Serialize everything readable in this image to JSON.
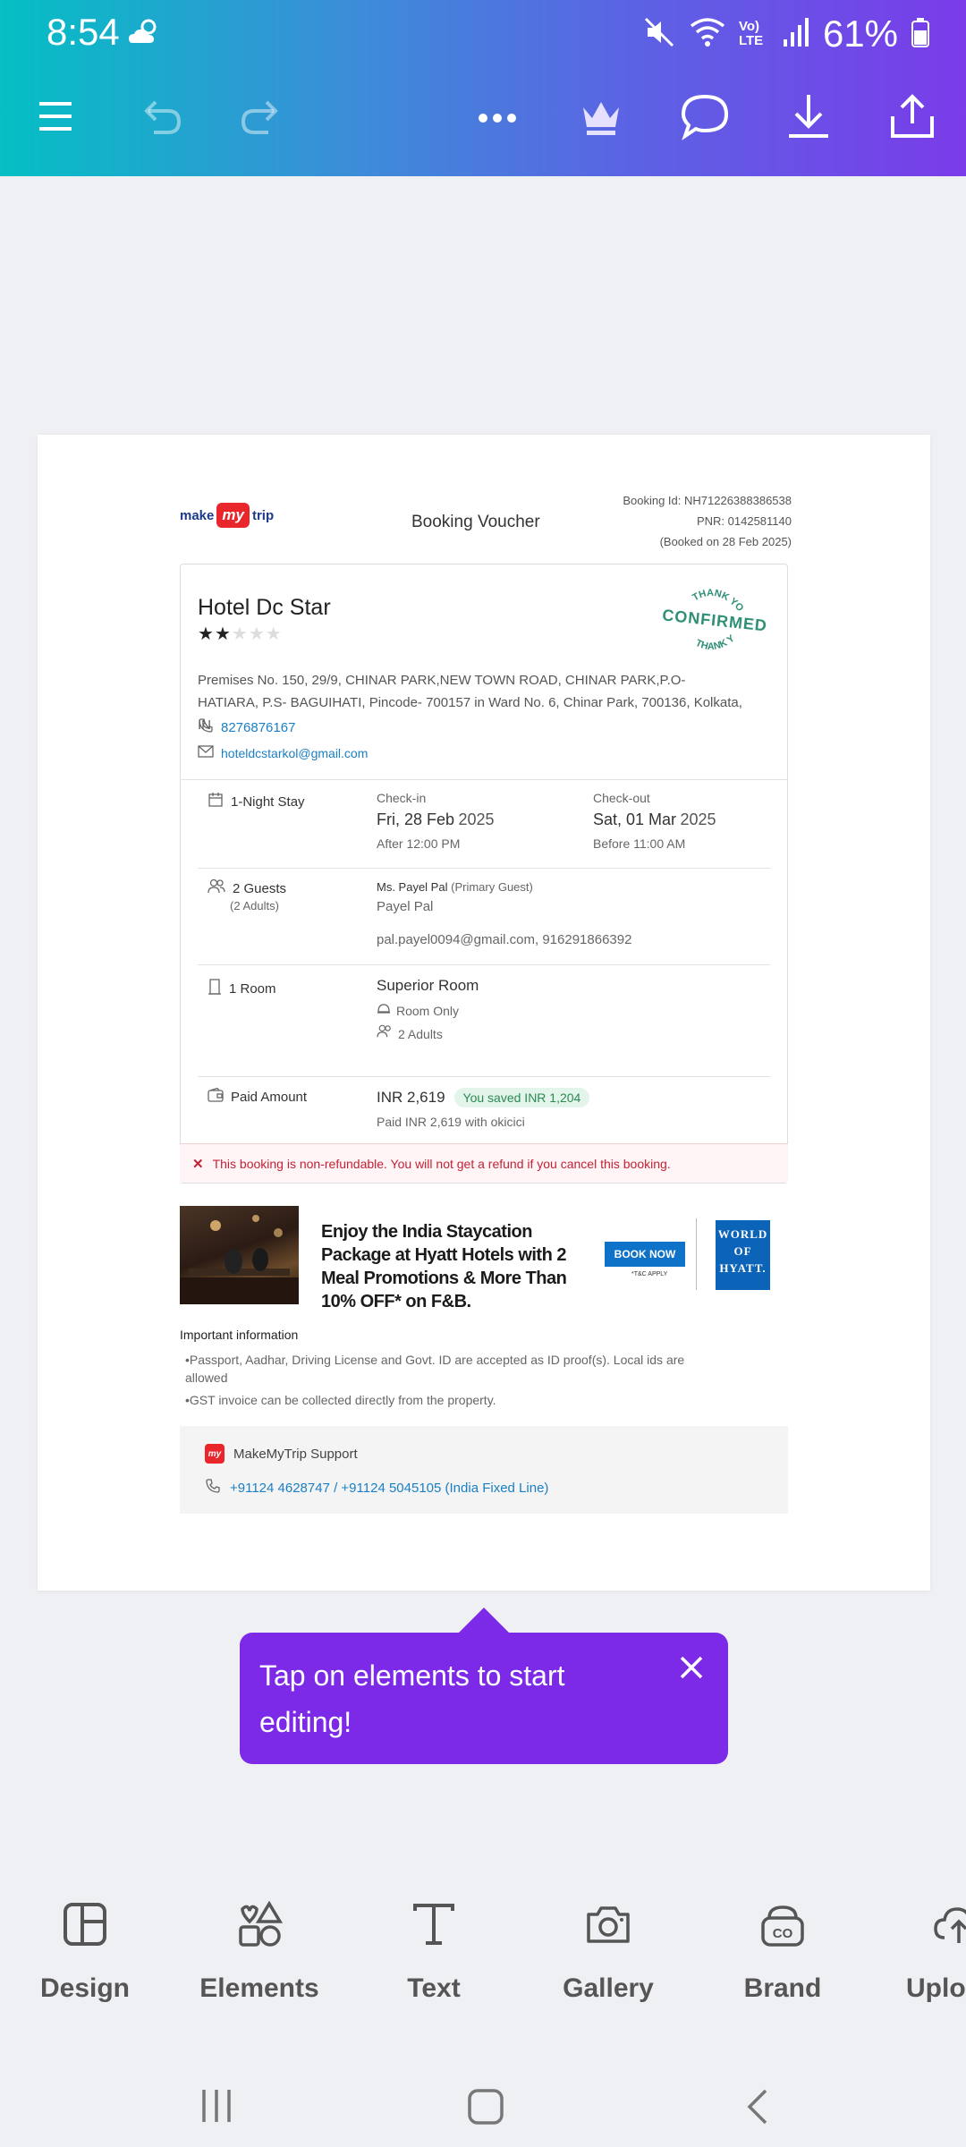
{
  "status_bar": {
    "time": "8:54",
    "battery": "61%",
    "network": "Vo) LTE"
  },
  "toolbar": {
    "menu": "menu-icon",
    "undo": "undo-icon",
    "redo": "redo-icon",
    "more": "more-icon",
    "premium": "crown-icon",
    "comment": "comment-icon",
    "download": "download-icon",
    "share": "share-icon"
  },
  "voucher": {
    "logo": {
      "make": "make",
      "my": "my",
      "trip": "trip"
    },
    "title": "Booking Voucher",
    "booking_id": "Booking Id: NH71226388386538",
    "pnr": "PNR: 0142581140",
    "booked_on": "(Booked on 28 Feb 2025)",
    "hotel": {
      "name": "Hotel Dc Star",
      "stars_filled": 2,
      "stars_total": 5,
      "address": "Premises No. 150, 29/9, CHINAR PARK,NEW TOWN ROAD, CHINAR PARK,P.O- HATIARA, P.S- BAGUIHATI, Pincode- 700157 in Ward No. 6, Chinar Park, 700136, Kolkata, IN",
      "phone": "8276876167",
      "email": "hoteldcstarkol@gmail.com"
    },
    "stamp": {
      "top": "THANK YOU",
      "main": "CONFIRMED",
      "bottom": "THANK YOU"
    },
    "stay": {
      "label": "1-Night Stay",
      "checkin_label": "Check-in",
      "checkin_day": "Fri, 28 Feb",
      "checkin_year": "2025",
      "checkin_time": "After 12:00 PM",
      "checkout_label": "Check-out",
      "checkout_day": "Sat, 01 Mar",
      "checkout_year": "2025",
      "checkout_time": "Before 11:00 AM"
    },
    "guests": {
      "label": "2 Guests",
      "sub": "(2 Adults)",
      "primary_name": "Ms. Payel Pal",
      "primary_tag": "(Primary Guest)",
      "second": "Payel Pal",
      "contact": "pal.payel0094@gmail.com, 916291866392"
    },
    "room": {
      "label": "1 Room",
      "type": "Superior Room",
      "meal": "Room Only",
      "occupancy": "2 Adults"
    },
    "payment": {
      "label": "Paid Amount",
      "amount": "INR 2,619",
      "saved": "You saved INR 1,204",
      "paid_with": "Paid INR 2,619 with okicici"
    },
    "non_refundable": "This booking is non-refundable. You will not get a refund if you cancel this booking.",
    "ad": {
      "text": "Enjoy the India Staycation Package at Hyatt Hotels with 2 Meal Promotions & More Than 10% OFF* on F&B.",
      "button": "BOOK NOW",
      "tc": "*T&C APPLY",
      "brand_line1": "WORLD",
      "brand_line2": "OF",
      "brand_line3": "HYATT."
    },
    "important": {
      "heading": "Important information",
      "item1": "•Passport, Aadhar, Driving License and Govt. ID are accepted as ID proof(s). Local ids are allowed",
      "item2": "•GST invoice can be collected directly from the property."
    },
    "support": {
      "title": "MakeMyTrip Support",
      "phones": "+91124 4628747 / +91124 5045105 (India Fixed Line)"
    }
  },
  "tooltip": {
    "message": "Tap on elements to start editing!"
  },
  "bottom_nav": [
    {
      "label": "Design",
      "icon": "design-icon"
    },
    {
      "label": "Elements",
      "icon": "elements-icon"
    },
    {
      "label": "Text",
      "icon": "text-icon"
    },
    {
      "label": "Gallery",
      "icon": "camera-icon"
    },
    {
      "label": "Brand",
      "icon": "brand-icon"
    },
    {
      "label": "Uplo",
      "icon": "upload-icon"
    }
  ],
  "colors": {
    "accent": "#7d2ae8",
    "link": "#1a7fc4",
    "danger": "#c32236",
    "stamp": "#2f8f77"
  }
}
